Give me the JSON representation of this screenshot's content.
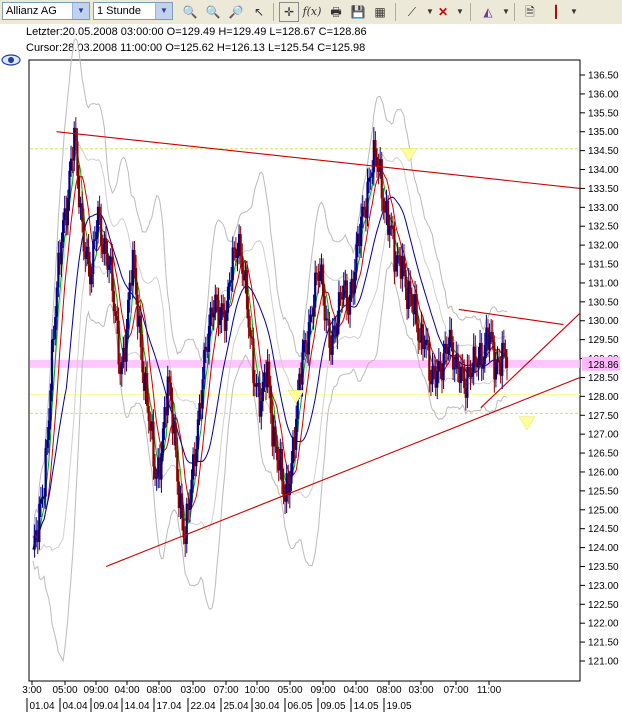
{
  "toolbar": {
    "symbol_select": "Allianz AG",
    "interval_select": "1 Stunde"
  },
  "info": {
    "last_line": "Letzter:20.05.2008 03:00:00 O=129.49 H=129.49 L=128.67 C=128.86",
    "cursor_line": "Cursor:28.03.2008 11:00:00 O=125.62 H=126.13 L=125.54 C=125.98"
  },
  "colors": {
    "trendline": "#cc0000",
    "bollinger": "#bbbbbb",
    "ma_fast": "#00aa00",
    "ma_mid": "#cc0000",
    "ma_slow": "#000099",
    "candle_up": "#000088",
    "candle_down": "#880000",
    "price_band": "#ffb8ff",
    "signal": "#ffff99"
  },
  "chart_data": {
    "type": "candlestick",
    "ylim": [
      121.0,
      136.5
    ],
    "y_ticks": [
      "136.50",
      "136.00",
      "135.50",
      "135.00",
      "134.50",
      "134.00",
      "133.50",
      "133.00",
      "132.50",
      "132.00",
      "131.50",
      "131.00",
      "130.50",
      "130.00",
      "129.50",
      "129.00",
      "128.50",
      "128.00",
      "127.50",
      "127.00",
      "126.50",
      "126.00",
      "125.50",
      "125.00",
      "124.50",
      "124.00",
      "123.50",
      "123.00",
      "122.50",
      "122.00",
      "121.50",
      "121.00"
    ],
    "current_price_label": "128.86",
    "x_ticks": [
      {
        "time": "3:00",
        "date": "01.04"
      },
      {
        "time": "05:00",
        "date": "04.04"
      },
      {
        "time": "09:00",
        "date": "09.04"
      },
      {
        "time": "04:00",
        "date": "14.04"
      },
      {
        "time": "08:00",
        "date": "17.04"
      },
      {
        "time": "03:00",
        "date": "22.04"
      },
      {
        "time": "07:00",
        "date": "25.04"
      },
      {
        "time": "10:00",
        "date": "30.04"
      },
      {
        "time": "05:00",
        "date": "06.05"
      },
      {
        "time": "09:00",
        "date": "09.05"
      },
      {
        "time": "04:00",
        "date": "14.05"
      },
      {
        "time": "08:00",
        "date": "19.05"
      },
      {
        "time": "03:00",
        "date": ""
      },
      {
        "time": "07:00",
        "date": ""
      },
      {
        "time": "11:00",
        "date": ""
      }
    ],
    "close_path": [
      123.8,
      124.5,
      126,
      128.5,
      130.5,
      132.5,
      133.5,
      134.8,
      133,
      132,
      131,
      132.8,
      132.2,
      131.5,
      130,
      128.8,
      129.8,
      131.5,
      130.2,
      128.5,
      127,
      125.8,
      126.8,
      128.2,
      127.2,
      125.5,
      124.1,
      125.5,
      127.2,
      128.5,
      129.5,
      130.8,
      130.2,
      129.8,
      131.8,
      132.2,
      131,
      129.8,
      128.5,
      127.6,
      128.8,
      127.2,
      126.2,
      125.1,
      126.2,
      127.5,
      128.8,
      129.8,
      130.8,
      131.2,
      130.2,
      129.5,
      129.8,
      131,
      130.6,
      131.2,
      132.5,
      133.5,
      134.2,
      134,
      133.2,
      132.6,
      131.2,
      131.8,
      130.8,
      130.2,
      129.6,
      129.8,
      128.2,
      128.6,
      129.1,
      129.4,
      128.7,
      129,
      128.2,
      128.6,
      129.3,
      129.1,
      129.5,
      128.9,
      129.2,
      128.86
    ],
    "trendlines": [
      {
        "from": {
          "bar": 0.05,
          "price": 135.0
        },
        "to": {
          "bar": 1.0,
          "price": 133.5
        }
      },
      {
        "from": {
          "bar": 0.14,
          "price": 123.5
        },
        "to": {
          "bar": 1.0,
          "price": 128.5
        }
      },
      {
        "from": {
          "bar": 0.78,
          "price": 130.3
        },
        "to": {
          "bar": 0.97,
          "price": 129.9
        }
      },
      {
        "from": {
          "bar": 0.82,
          "price": 127.7
        },
        "to": {
          "bar": 1.0,
          "price": 130.2
        }
      }
    ],
    "signal_markers": [
      {
        "label": "down",
        "price": 134.4
      },
      {
        "label": "down",
        "price": 128.0
      },
      {
        "label": "down",
        "price": 127.3
      }
    ],
    "grid": false,
    "legend": "none"
  }
}
